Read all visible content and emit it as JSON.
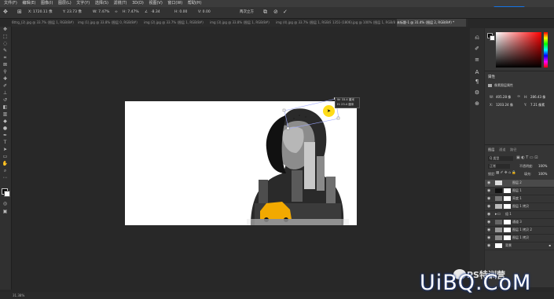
{
  "menubar": {
    "items": [
      "文件(F)",
      "编辑(E)",
      "图像(I)",
      "图层(L)",
      "文字(Y)",
      "选择(S)",
      "滤镜(T)",
      "3D(D)",
      "视图(V)",
      "窗口(W)",
      "帮助(H)"
    ]
  },
  "options_bar": {
    "x_value": "X: 1720.11 像",
    "y_value": "Y: 23.73 像",
    "w_value": "W: 7.47%",
    "h_value": "H: 7.47%",
    "angle_value": "-8.34",
    "h_skew": "H: 0.00",
    "v_skew": "V: 0.00",
    "interpolation": "两次立方",
    "cancel_icon": "cancel-icon",
    "commit_icon": "commit-icon"
  },
  "window_button": "升级文件",
  "tabs": [
    {
      "label": "6ttrg_(2).jpg @ 33.7% (图层 1, RGB/8#)",
      "active": false
    },
    {
      "label": "img (1).jpg @ 33.8% (图层 0, RGB/8#)",
      "active": false
    },
    {
      "label": "img (2).jpg @ 33.7% (图层 1, RGB/8#)",
      "active": false
    },
    {
      "label": "img (3).jpg @ 33.8% (图层 1, RGB/8#)",
      "active": false
    },
    {
      "label": "img (4).jpg @ 33.7% (图层 1, RGB/8#)",
      "active": false
    },
    {
      "label": "1351-(1806).jpg @ 100% (图层 1, RGB/8#)",
      "active": false
    },
    {
      "label": "未标题-1 @ 31.4% (图层 2, RGB/8#) *",
      "active": true
    }
  ],
  "tooltip": {
    "w_line": "W: 33.4 厘米",
    "h_line": "H: 23.4 厘米"
  },
  "properties": {
    "tab_label": "属性",
    "subtitle": "像素图层属性",
    "w_label": "W:",
    "w_value": "405.28 像",
    "h_label": "H:",
    "h_value": "286.43 像",
    "x_label": "X:",
    "x_value": "1203.24 像",
    "y_label": "Y:",
    "y_value": "7.21 像素"
  },
  "layers_panel": {
    "tabs": [
      "图层",
      "通道",
      "路径"
    ],
    "search_placeholder": "Q 类型",
    "blend_mode": "正常",
    "opacity_label": "不透明度:",
    "opacity_value": "100%",
    "fill_label": "填充:",
    "fill_value": "100%",
    "lock_label": "锁定:",
    "layers": [
      {
        "name": "图层 2",
        "selected": true
      },
      {
        "name": "图层 1",
        "selected": false
      },
      {
        "name": "亮度 1",
        "selected": false
      },
      {
        "name": "图层 1 拷贝",
        "selected": false
      },
      {
        "name": "组 1",
        "selected": false
      },
      {
        "name": "通道 3",
        "selected": false
      },
      {
        "name": "图层 1 拷贝 2",
        "selected": false
      },
      {
        "name": "图层 1 拷贝",
        "selected": false
      },
      {
        "name": "背景",
        "selected": false
      }
    ]
  },
  "status": {
    "zoom": "31.38%"
  },
  "watermark": {
    "text": "UiBQ.CoM",
    "small_text": "PS特训营"
  },
  "colors": {
    "accent": "#1473e6",
    "panel_bg": "#353535",
    "canvas_bg": "#ffffff",
    "taxi": "#f2a900",
    "cursor_highlight": "#ffd800"
  }
}
